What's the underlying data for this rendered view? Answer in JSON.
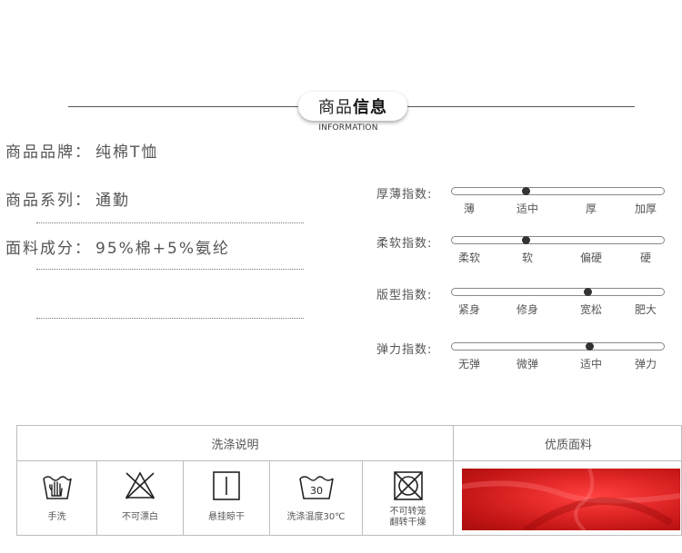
{
  "header": {
    "title_normal": "商品",
    "title_bold": "信息",
    "subtitle": "INFORMATION"
  },
  "info": [
    {
      "label": "商品品牌",
      "value": "纯棉T恤"
    },
    {
      "label": "商品系列",
      "value": "通勤"
    },
    {
      "label": "面料成分",
      "value": "95%棉+5%氨纶"
    }
  ],
  "info_separator": "：",
  "indices": [
    {
      "label": "厚薄指数:",
      "ticks": [
        "薄",
        "适中",
        "厚",
        "加厚"
      ],
      "level": 0.35
    },
    {
      "label": "柔软指数:",
      "ticks": [
        "柔软",
        "软",
        "偏硬",
        "硬"
      ],
      "level": 0.35
    },
    {
      "label": "版型指数:",
      "ticks": [
        "紧身",
        "修身",
        "宽松",
        "肥大"
      ],
      "level": 0.64
    },
    {
      "label": "弹力指数:",
      "ticks": [
        "无弹",
        "微弹",
        "适中",
        "弹力"
      ],
      "level": 0.65
    }
  ],
  "washing": {
    "header": "洗涤说明",
    "items": [
      {
        "label": "手洗",
        "icon": "hand-wash-icon"
      },
      {
        "label": "不可漂白",
        "icon": "no-bleach-icon"
      },
      {
        "label": "悬挂晾干",
        "icon": "line-dry-icon"
      },
      {
        "label": "洗涤温度30℃",
        "icon": "wash-30-icon",
        "temp": "30"
      },
      {
        "label": "不可转笼\n翻转干燥",
        "icon": "no-tumble-dry-icon"
      }
    ]
  },
  "fabric": {
    "header": "优质面料",
    "color": "#e52a2a"
  }
}
